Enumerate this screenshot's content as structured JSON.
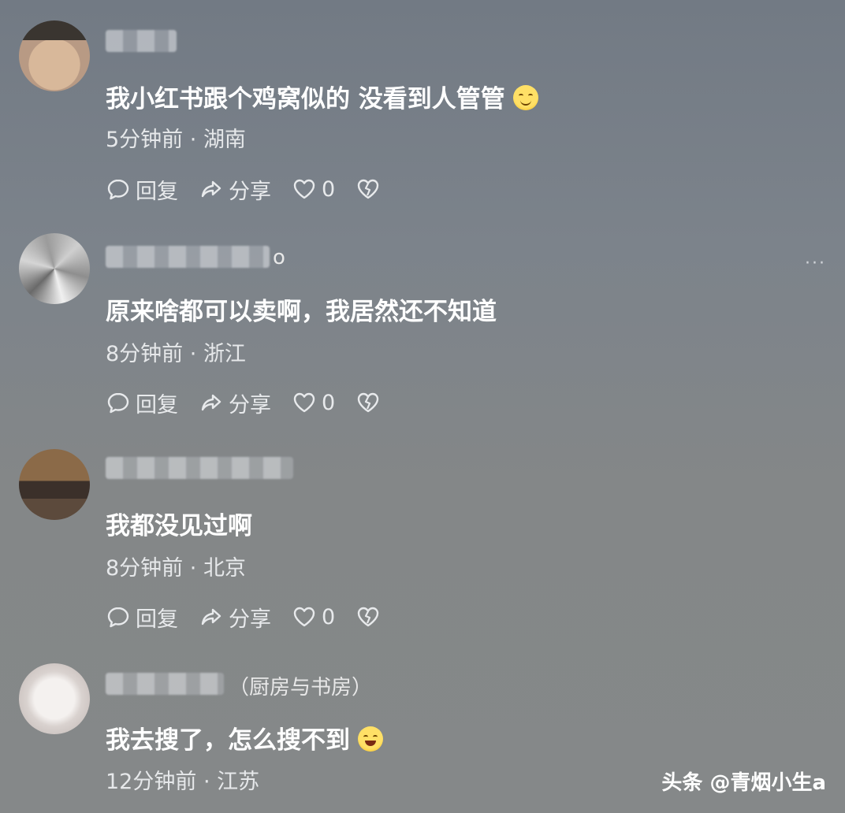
{
  "comments": [
    {
      "name_suffix": "",
      "text": "我小红书跟个鸡窝似的 没看到人管管",
      "emoji": "smiling-face-emoji",
      "time": "5分钟前",
      "location": "湖南",
      "reply_label": "回复",
      "share_label": "分享",
      "like_count": "0"
    },
    {
      "name_suffix": "o",
      "text": "原来啥都可以卖啊，我居然还不知道",
      "time": "8分钟前",
      "location": "浙江",
      "reply_label": "回复",
      "share_label": "分享",
      "like_count": "0",
      "more_label": "···"
    },
    {
      "name_suffix": "",
      "text": "我都没见过啊",
      "time": "8分钟前",
      "location": "北京",
      "reply_label": "回复",
      "share_label": "分享",
      "like_count": "0"
    },
    {
      "name_suffix": "（厨房与书房）",
      "text": "我去搜了，怎么搜不到",
      "emoji": "laughing-face-emoji",
      "time": "12分钟前",
      "location": "江苏"
    }
  ],
  "meta_separator": " · ",
  "watermark": "头条 @青烟小生a"
}
